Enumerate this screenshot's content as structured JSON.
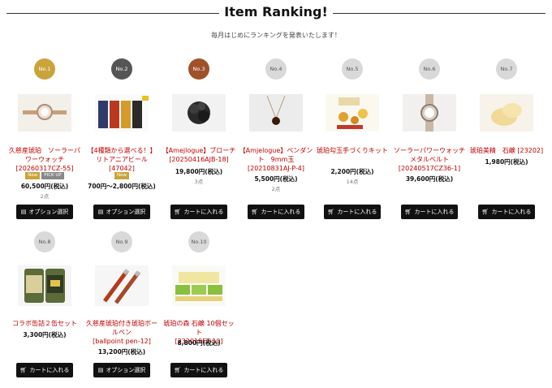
{
  "header": {
    "title": "Item Ranking!",
    "subtitle": "毎月はじめにランキングを発表いたします！"
  },
  "badges": {
    "new": "New",
    "pickup": "PICK UP"
  },
  "buttons": {
    "option": "オプション選択",
    "cart": "カートに入れる"
  },
  "items": [
    {
      "rank": "No.1",
      "name": "久慈産琥珀　ソーラーパワーウォッチ",
      "code": "[20260317CZ-55]",
      "price": "60,500円(税込)",
      "count": "2点",
      "button": "option",
      "new": true,
      "pickup": true
    },
    {
      "rank": "No.2",
      "name": "【4種類から選べる！】リトアニアビール",
      "code": "[47042]",
      "price": "700円～2,800円(税込)",
      "count": "",
      "button": "option",
      "new": true,
      "pickup": false
    },
    {
      "rank": "No.3",
      "name": "【Amejlogue】ブローチ",
      "code": "[20250416AJB-18]",
      "price": "19,800円(税込)",
      "count": "3点",
      "button": "cart",
      "new": false,
      "pickup": false
    },
    {
      "rank": "No.4",
      "name": "【Amjelogue】ペンダント　9mm玉",
      "code": "[20210831AJ-P-4]",
      "price": "5,500円(税込)",
      "count": "2点",
      "button": "cart",
      "new": false,
      "pickup": false
    },
    {
      "rank": "No.5",
      "name": "琥珀勾玉手づくりキット",
      "code": "",
      "price": "2,200円(税込)",
      "count": "14点",
      "button": "cart",
      "new": false,
      "pickup": false
    },
    {
      "rank": "No.6",
      "name": "ソーラーパワーウォッチ メタルベルト",
      "code": "[20240517CZ36-1]",
      "price": "39,600円(税込)",
      "count": "",
      "button": "cart",
      "new": false,
      "pickup": false
    },
    {
      "rank": "No.7",
      "name": "琥珀美精　石鹸",
      "code": "[23202]",
      "price": "1,980円(税込)",
      "count": "",
      "button": "cart",
      "new": false,
      "pickup": false
    },
    {
      "rank": "No.8",
      "name": "コラボ缶詰２缶セット",
      "code": "",
      "price": "3,300円(税込)",
      "count": "",
      "button": "cart",
      "new": false,
      "pickup": false
    },
    {
      "rank": "No.9",
      "name": "久慈産琥珀付き琥珀ボールペン",
      "code": "[ballpoint pen-12]",
      "price": "13,200円(税込)",
      "count": "",
      "button": "option",
      "new": false,
      "pickup": false
    },
    {
      "rank": "No.10",
      "name": "琥珀の森 石鹸 10個セット",
      "code": "[23201SET-10]",
      "price": "8,800円(税込)",
      "count": "",
      "button": "cart",
      "new": false,
      "pickup": false
    }
  ]
}
